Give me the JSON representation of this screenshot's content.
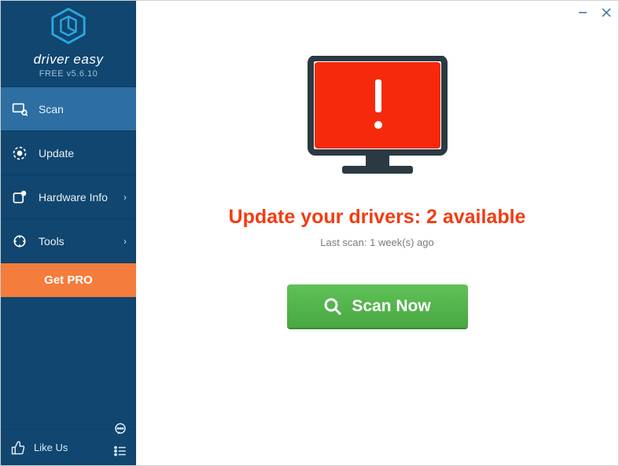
{
  "brand": {
    "name": "driver easy",
    "version": "FREE v5.6.10"
  },
  "sidebar": {
    "items": [
      {
        "label": "Scan",
        "has_sub": false,
        "active": true
      },
      {
        "label": "Update",
        "has_sub": false,
        "active": false
      },
      {
        "label": "Hardware Info",
        "has_sub": true,
        "active": false
      },
      {
        "label": "Tools",
        "has_sub": true,
        "active": false
      }
    ],
    "get_pro_label": "Get PRO",
    "like_us_label": "Like Us"
  },
  "main": {
    "headline": "Update your drivers: 2 available",
    "subline": "Last scan: 1 week(s) ago",
    "scan_button_label": "Scan Now"
  },
  "colors": {
    "sidebar_bg": "#10466f",
    "accent_orange": "#f47c3c",
    "alert_red": "#f23c12",
    "scan_green": "#4fb84a"
  }
}
